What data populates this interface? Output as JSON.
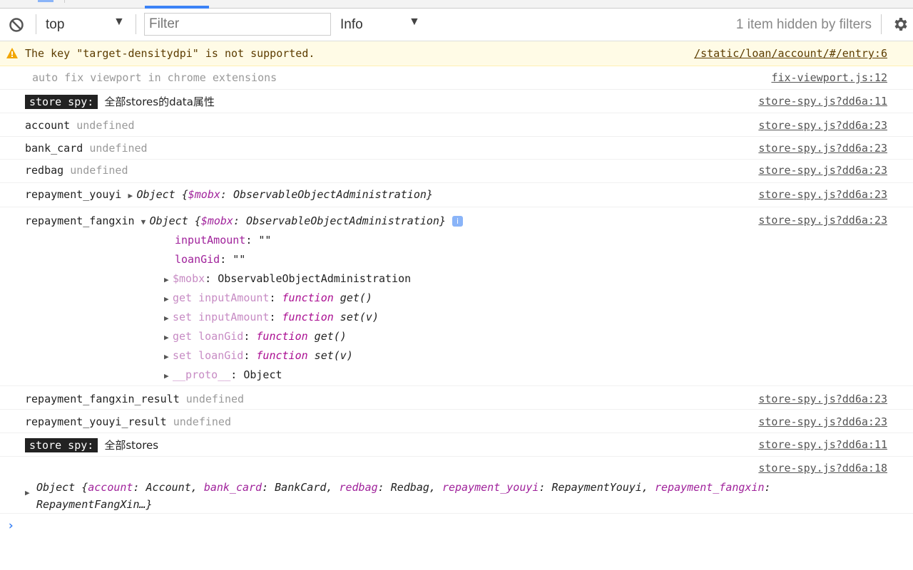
{
  "toolbar": {
    "context_value": "top",
    "filter_placeholder": "Filter",
    "filter_value": "",
    "level_value": "Info",
    "hidden_status": "1 item hidden by filters",
    "dropdown_glyph": "▼"
  },
  "messages": [
    {
      "type": "warning",
      "text": "The key \"target-densitydpi\" is not supported.",
      "source": "/static/loan/account/#/entry:6"
    },
    {
      "type": "log",
      "text": "auto fix viewport in chrome extensions",
      "source": "fix-viewport.js:12"
    },
    {
      "type": "log",
      "badge": "store spy:",
      "text": "全部stores的data属性",
      "source": "store-spy.js?dd6a:11"
    },
    {
      "type": "log",
      "key": "account",
      "value": "undefined",
      "source": "store-spy.js?dd6a:23"
    },
    {
      "type": "log",
      "key": "bank_card",
      "value": "undefined",
      "source": "store-spy.js?dd6a:23"
    },
    {
      "type": "log",
      "key": "redbag",
      "value": "undefined",
      "source": "store-spy.js?dd6a:23"
    },
    {
      "type": "log",
      "key": "repayment_youyi",
      "object_prefix": "Object {",
      "object_prop": "$mobx",
      "object_value": ": ObservableObjectAdministration}",
      "source": "store-spy.js?dd6a:23"
    },
    {
      "type": "log",
      "key": "repayment_fangxin",
      "object_prefix": "Object {",
      "object_prop": "$mobx",
      "object_value": ": ObservableObjectAdministration}",
      "source": "store-spy.js?dd6a:23",
      "expanded": [
        {
          "name": "inputAmount",
          "sep": ": ",
          "value": "\"\""
        },
        {
          "name": "loanGid",
          "sep": ": ",
          "value": "\"\""
        },
        {
          "name": "$mobx",
          "sep": ": ",
          "value": "ObservableObjectAdministration"
        },
        {
          "name": "get inputAmount",
          "sep": ": ",
          "fn": "function",
          "value": " get()"
        },
        {
          "name": "set inputAmount",
          "sep": ": ",
          "fn": "function",
          "value": " set(v)"
        },
        {
          "name": "get loanGid",
          "sep": ": ",
          "fn": "function",
          "value": " get()"
        },
        {
          "name": "set loanGid",
          "sep": ": ",
          "fn": "function",
          "value": " set(v)"
        },
        {
          "name": "__proto__",
          "sep": ": ",
          "value": "Object"
        }
      ]
    },
    {
      "type": "log",
      "key": "repayment_fangxin_result",
      "value": "undefined",
      "source": "store-spy.js?dd6a:23"
    },
    {
      "type": "log",
      "key": "repayment_youyi_result",
      "value": "undefined",
      "source": "store-spy.js?dd6a:23"
    },
    {
      "type": "log",
      "badge": "store spy:",
      "text": "全部stores",
      "source": "store-spy.js?dd6a:11"
    },
    {
      "type": "log",
      "source": "store-spy.js?dd6a:18",
      "summary": [
        {
          "t": "Object {"
        },
        {
          "p": "account"
        },
        {
          "t": ": Account, "
        },
        {
          "p": "bank_card"
        },
        {
          "t": ": BankCard, "
        },
        {
          "p": "redbag"
        },
        {
          "t": ": Redbag, "
        },
        {
          "p": "repayment_youyi"
        },
        {
          "t": ": RepaymentYouyi, "
        },
        {
          "p": "repayment_fangxin"
        },
        {
          "t": ":"
        }
      ],
      "summary_line2": "RepaymentFangXin…}"
    }
  ],
  "prompt_glyph": "›"
}
